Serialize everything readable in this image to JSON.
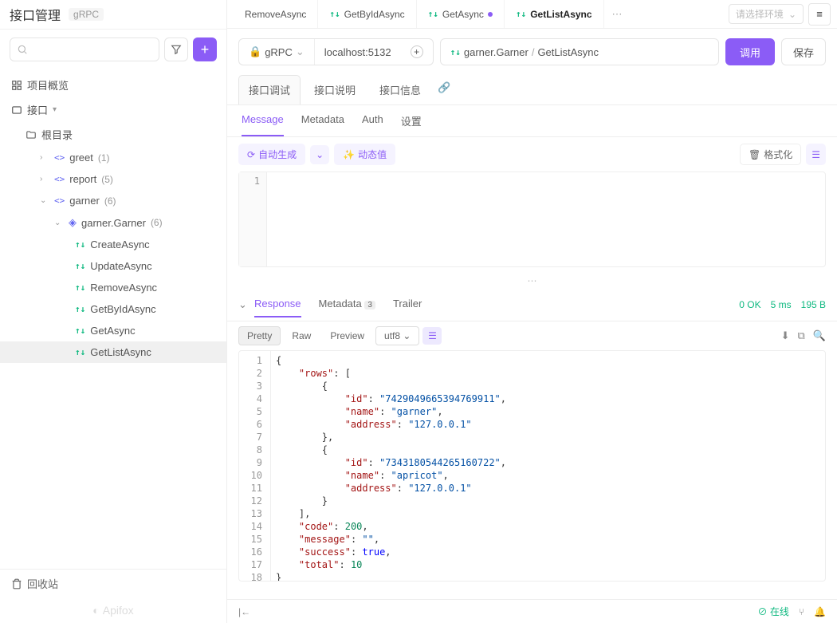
{
  "sidebar": {
    "title": "接口管理",
    "tag": "gRPC",
    "overview": "项目概览",
    "interface_label": "接口",
    "root": "根目录",
    "recycle": "回收站",
    "brand": "Apifox",
    "folders": [
      {
        "name": "greet",
        "count": "(1)"
      },
      {
        "name": "report",
        "count": "(5)"
      },
      {
        "name": "garner",
        "count": "(6)",
        "open": true,
        "services": [
          {
            "name": "garner.Garner",
            "count": "(6)",
            "methods": [
              "CreateAsync",
              "UpdateAsync",
              "RemoveAsync",
              "GetByIdAsync",
              "GetAsync",
              "GetListAsync"
            ]
          }
        ]
      }
    ]
  },
  "tabs": [
    {
      "name": "RemoveAsync"
    },
    {
      "name": "GetByIdAsync"
    },
    {
      "name": "GetAsync",
      "dirty": true
    },
    {
      "name": "GetListAsync",
      "active": true
    }
  ],
  "env": {
    "placeholder": "请选择环境"
  },
  "request": {
    "proto": "gRPC",
    "host": "localhost:5132",
    "service": "garner.Garner",
    "method": "GetListAsync",
    "invoke": "调用",
    "save": "保存"
  },
  "sub_tabs": {
    "debug": "接口调试",
    "doc": "接口说明",
    "info": "接口信息"
  },
  "body_tabs": {
    "message": "Message",
    "metadata": "Metadata",
    "auth": "Auth",
    "settings": "设置"
  },
  "tools": {
    "autogen": "自动生成",
    "dynamic": "动态值",
    "format": "格式化"
  },
  "response_tabs": {
    "response": "Response",
    "metadata": "Metadata",
    "meta_count": "3",
    "trailer": "Trailer"
  },
  "status": {
    "code": "0 OK",
    "time": "5 ms",
    "size": "195 B"
  },
  "resp_toolbar": {
    "pretty": "Pretty",
    "raw": "Raw",
    "preview": "Preview",
    "enc": "utf8"
  },
  "response_json": {
    "rows": [
      {
        "id": "7429049665394769911",
        "name": "garner",
        "address": "127.0.0.1"
      },
      {
        "id": "7343180544265160722",
        "name": "apricot",
        "address": "127.0.0.1"
      }
    ],
    "code": 200,
    "message": "",
    "success": true,
    "total": 10
  },
  "footer": {
    "online": "在线"
  }
}
